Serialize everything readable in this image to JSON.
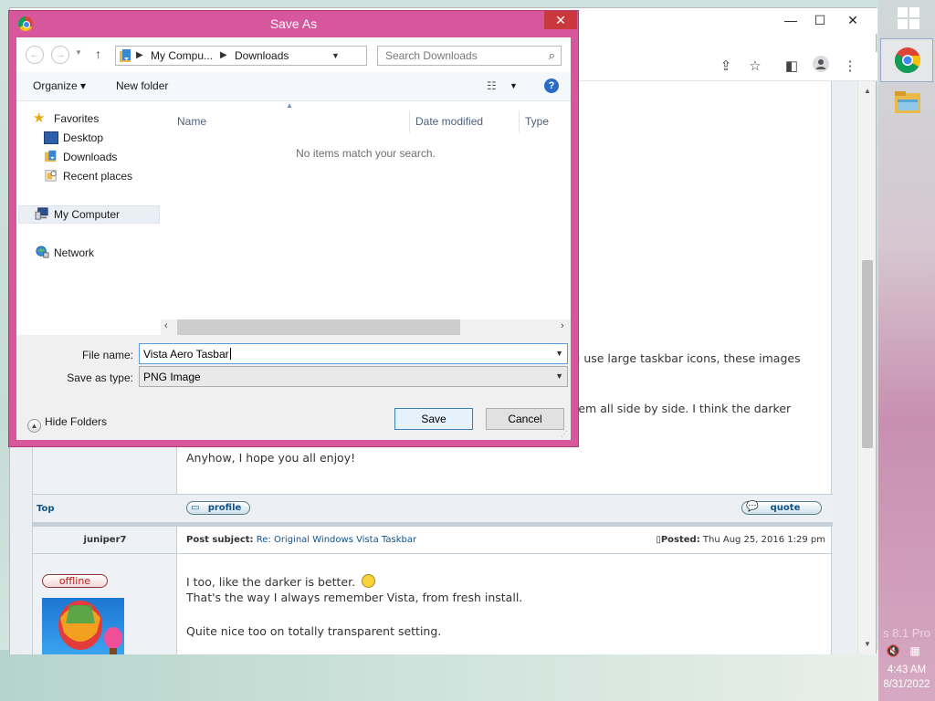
{
  "dialog": {
    "title": "Save As",
    "close_label": "✕",
    "breadcrumb": [
      "My Compu...",
      "Downloads"
    ],
    "search_placeholder": "Search Downloads",
    "organize_label": "Organize ▾",
    "new_folder_label": "New folder",
    "help_label": "?",
    "nav": {
      "favorites": "Favorites",
      "desktop": "Desktop",
      "downloads": "Downloads",
      "recent": "Recent places",
      "my_computer": "My Computer",
      "network": "Network"
    },
    "columns": [
      "Name",
      "Date modified",
      "Type"
    ],
    "empty_message": "No items match your search.",
    "file_name_label": "File name:",
    "file_name_value": "Vista Aero Tasbar",
    "save_type_label": "Save as type:",
    "save_type_value": "PNG Image",
    "hide_folders_label": "Hide Folders",
    "save_label": "Save",
    "cancel_label": "Cancel"
  },
  "browser": {
    "minimize": "—",
    "maximize": "☐",
    "close": "✕"
  },
  "forum": {
    "peek_line1": "f you use large taskbar icons, these images",
    "peek_line2": "at them all side by side. I think the darker",
    "closing_line": "Anyhow, I hope you all enjoy!",
    "top_link": "Top",
    "profile_label": "profile",
    "quote_label": "quote",
    "author": "juniper7",
    "subject_prefix": "Post subject:",
    "subject_link": "Re: Original Windows Vista Taskbar",
    "posted_label": "Posted:",
    "posted_value": "Thu Aug 25, 2016 1:29 pm",
    "status": "offline",
    "body_line1": "I too, like the darker is better.",
    "body_line2": "That's the way I always remember Vista, from fresh install.",
    "body_line3": "Quite nice too on totally transparent setting."
  },
  "taskbar": {
    "time": "4:43 AM",
    "date": "8/31/2022",
    "watermark": "s 8.1 Pro"
  }
}
